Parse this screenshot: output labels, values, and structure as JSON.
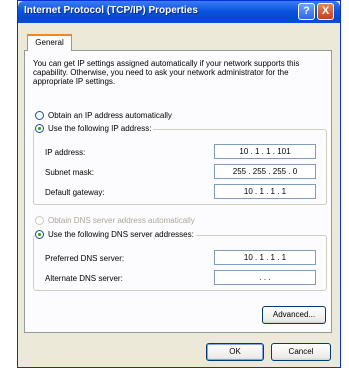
{
  "dialog": {
    "title": "Internet Protocol (TCP/IP) Properties",
    "help_button": "?",
    "close_button": "X"
  },
  "tabs": [
    {
      "label": "General",
      "selected": true
    }
  ],
  "description": "You can get IP settings assigned automatically if your network supports this capability. Otherwise, you need to ask your network administrator for the appropriate IP settings.",
  "ip_section": {
    "auto_option": {
      "label": "Obtain an IP address automatically",
      "selected": false
    },
    "manual_option": {
      "label": "Use the following IP address:",
      "selected": true
    },
    "fields": [
      {
        "label": "IP address:",
        "value": "10  .  1  .  1  . 101"
      },
      {
        "label": "Subnet mask:",
        "value": "255 . 255 . 255 .  0"
      },
      {
        "label": "Default gateway:",
        "value": "10  .  1  .  1  .  1"
      }
    ]
  },
  "dns_section": {
    "auto_option": {
      "label": "Obtain DNS server address automatically",
      "selected": false,
      "disabled": true
    },
    "manual_option": {
      "label": "Use the following DNS server addresses:",
      "selected": true
    },
    "fields": [
      {
        "label": "Preferred DNS server:",
        "value": "10  .  1  .  1  .  1"
      },
      {
        "label": "Alternate DNS server:",
        "value": ".      .      ."
      }
    ]
  },
  "buttons": {
    "advanced": "Advanced...",
    "ok": "OK",
    "cancel": "Cancel"
  },
  "colors": {
    "titlebar": "#0a54e0",
    "dialog_bg": "#ece9d8",
    "panel_bg": "#fcfcfe",
    "tab_highlight": "#e68b2c",
    "radio_dot": "#21a121"
  }
}
